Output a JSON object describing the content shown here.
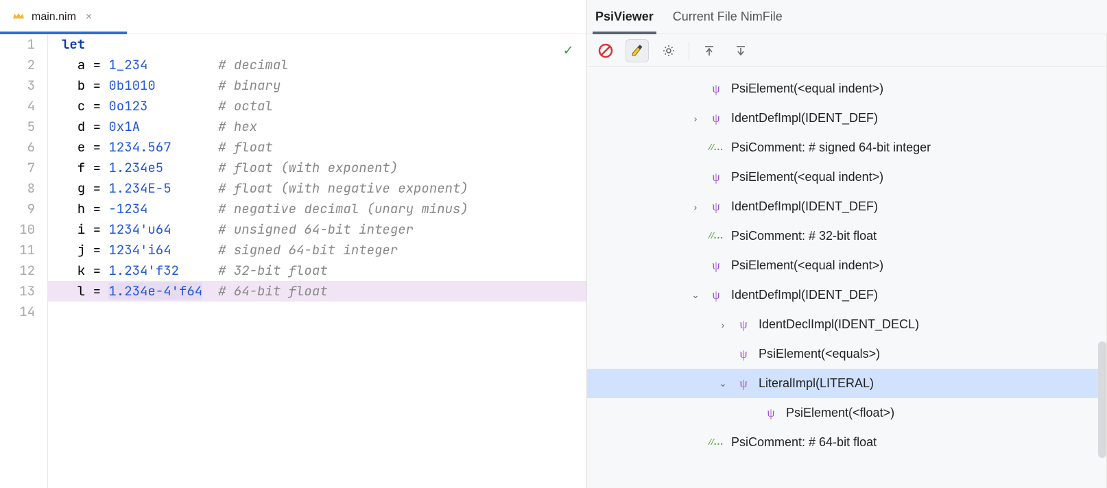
{
  "tab": {
    "filename": "main.nim"
  },
  "code": {
    "keyword": "let",
    "lines": [
      {
        "n": 1,
        "raw": "let"
      },
      {
        "n": 2,
        "var": "a",
        "val": "1_234",
        "comment": "# decimal"
      },
      {
        "n": 3,
        "var": "b",
        "val": "0b1010",
        "comment": "# binary"
      },
      {
        "n": 4,
        "var": "c",
        "val": "0o123",
        "comment": "# octal"
      },
      {
        "n": 5,
        "var": "d",
        "val": "0x1A",
        "comment": "# hex"
      },
      {
        "n": 6,
        "var": "e",
        "val": "1234.567",
        "comment": "# float"
      },
      {
        "n": 7,
        "var": "f",
        "val": "1.234e5",
        "comment": "# float (with exponent)"
      },
      {
        "n": 8,
        "var": "g",
        "val": "1.234E-5",
        "comment": "# float (with negative exponent)"
      },
      {
        "n": 9,
        "var": "h",
        "val": "-1234",
        "comment": "# negative decimal (unary minus)"
      },
      {
        "n": 10,
        "var": "i",
        "val": "1234'u64",
        "comment": "# unsigned 64-bit integer"
      },
      {
        "n": 11,
        "var": "j",
        "val": "1234'i64",
        "comment": "# signed 64-bit integer"
      },
      {
        "n": 12,
        "var": "k",
        "val": "1.234'f32",
        "comment": "# 32-bit float"
      },
      {
        "n": 13,
        "var": "l",
        "val": "1.234e-4'f64",
        "comment": "# 64-bit float",
        "highlighted": true,
        "selected_token": true
      },
      {
        "n": 14,
        "empty": true
      }
    ]
  },
  "sidePanel": {
    "tabs": [
      "PsiViewer",
      "Current File NimFile"
    ],
    "activeTab": 0
  },
  "tree": [
    {
      "indent": 1,
      "chev": "",
      "icon": "psi",
      "label": "PsiElement(<equal indent>)"
    },
    {
      "indent": 1,
      "chev": ">",
      "icon": "psi",
      "label": "IdentDefImpl(IDENT_DEF)"
    },
    {
      "indent": 1,
      "chev": "",
      "icon": "cmt",
      "label": "PsiComment: # signed 64-bit integer"
    },
    {
      "indent": 1,
      "chev": "",
      "icon": "psi",
      "label": "PsiElement(<equal indent>)"
    },
    {
      "indent": 1,
      "chev": ">",
      "icon": "psi",
      "label": "IdentDefImpl(IDENT_DEF)"
    },
    {
      "indent": 1,
      "chev": "",
      "icon": "cmt",
      "label": "PsiComment: # 32-bit float"
    },
    {
      "indent": 1,
      "chev": "",
      "icon": "psi",
      "label": "PsiElement(<equal indent>)"
    },
    {
      "indent": 1,
      "chev": "v",
      "icon": "psi",
      "label": "IdentDefImpl(IDENT_DEF)"
    },
    {
      "indent": 2,
      "chev": ">",
      "icon": "psi",
      "label": "IdentDeclImpl(IDENT_DECL)"
    },
    {
      "indent": 2,
      "chev": "",
      "icon": "psi",
      "label": "PsiElement(<equals>)"
    },
    {
      "indent": 2,
      "chev": "v",
      "icon": "psi",
      "label": "LiteralImpl(LITERAL)",
      "selected": true
    },
    {
      "indent": 3,
      "chev": "",
      "icon": "psi",
      "label": "PsiElement(<float>)"
    },
    {
      "indent": 1,
      "chev": "",
      "icon": "cmt",
      "label": "PsiComment: # 64-bit float"
    }
  ]
}
